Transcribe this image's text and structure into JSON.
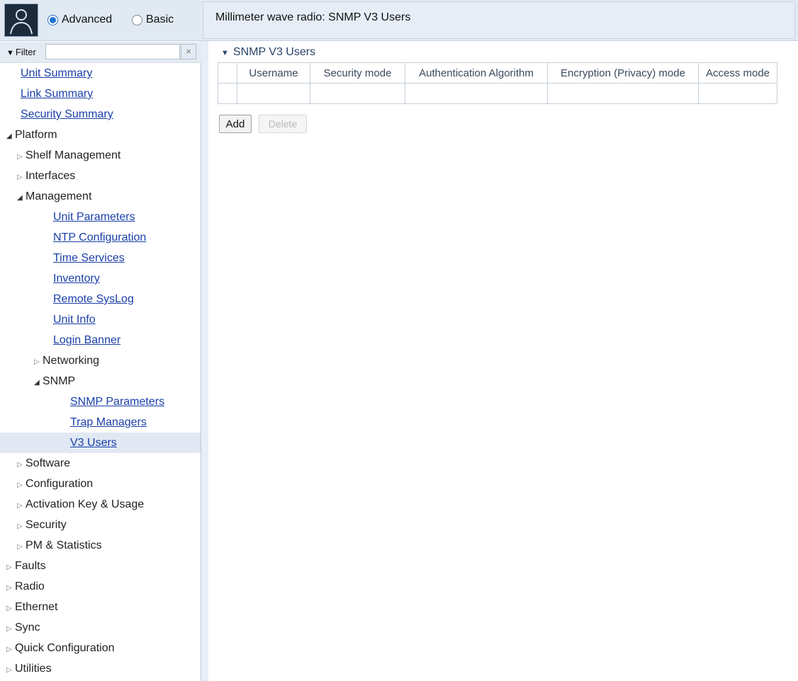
{
  "sidebar": {
    "mode_options": [
      {
        "label": "Advanced",
        "selected": true
      },
      {
        "label": "Basic",
        "selected": false
      }
    ],
    "filter": {
      "label": "Filter",
      "value": "",
      "clear_label": "×"
    },
    "nav": [
      {
        "label": "Unit Summary",
        "level": 0,
        "type": "link"
      },
      {
        "label": "Link Summary",
        "level": 0,
        "type": "link"
      },
      {
        "label": "Security Summary",
        "level": 0,
        "type": "link"
      },
      {
        "label": "Platform",
        "level": 0,
        "type": "folder",
        "expanded": true
      },
      {
        "label": "Shelf Management",
        "level": 1,
        "type": "folder",
        "expanded": false
      },
      {
        "label": "Interfaces",
        "level": 1,
        "type": "folder",
        "expanded": false
      },
      {
        "label": "Management",
        "level": 1,
        "type": "folder",
        "expanded": true
      },
      {
        "label": "Unit Parameters",
        "level": 2,
        "type": "link"
      },
      {
        "label": "NTP Configuration",
        "level": 2,
        "type": "link"
      },
      {
        "label": "Time Services",
        "level": 2,
        "type": "link"
      },
      {
        "label": "Inventory",
        "level": 2,
        "type": "link"
      },
      {
        "label": "Remote SysLog",
        "level": 2,
        "type": "link"
      },
      {
        "label": "Unit Info",
        "level": 2,
        "type": "link"
      },
      {
        "label": "Login Banner",
        "level": 2,
        "type": "link"
      },
      {
        "label": "Networking",
        "level": 2,
        "type": "folder",
        "expanded": false
      },
      {
        "label": "SNMP",
        "level": 2,
        "type": "folder",
        "expanded": true
      },
      {
        "label": "SNMP Parameters",
        "level": 3,
        "type": "link"
      },
      {
        "label": "Trap Managers",
        "level": 3,
        "type": "link"
      },
      {
        "label": "V3 Users",
        "level": 3,
        "type": "link",
        "selected": true
      },
      {
        "label": "Software",
        "level": 1,
        "type": "folder",
        "expanded": false
      },
      {
        "label": "Configuration",
        "level": 1,
        "type": "folder",
        "expanded": false
      },
      {
        "label": "Activation Key & Usage",
        "level": 1,
        "type": "folder",
        "expanded": false
      },
      {
        "label": "Security",
        "level": 1,
        "type": "folder",
        "expanded": false
      },
      {
        "label": "PM & Statistics",
        "level": 1,
        "type": "folder",
        "expanded": false
      },
      {
        "label": "Faults",
        "level": 0,
        "type": "folder",
        "expanded": false
      },
      {
        "label": "Radio",
        "level": 0,
        "type": "folder",
        "expanded": false
      },
      {
        "label": "Ethernet",
        "level": 0,
        "type": "folder",
        "expanded": false
      },
      {
        "label": "Sync",
        "level": 0,
        "type": "folder",
        "expanded": false
      },
      {
        "label": "Quick Configuration",
        "level": 0,
        "type": "folder",
        "expanded": false
      },
      {
        "label": "Utilities",
        "level": 0,
        "type": "folder",
        "expanded": false
      }
    ]
  },
  "main": {
    "title": "Millimeter wave radio: SNMP V3 Users",
    "section_title": "SNMP V3 Users",
    "table": {
      "columns": [
        "",
        "Username",
        "Security mode",
        "Authentication Algorithm",
        "Encryption (Privacy) mode",
        "Access mode"
      ],
      "rows": []
    },
    "buttons": {
      "add": "Add",
      "delete": "Delete"
    }
  },
  "colors": {
    "header_bg": "#e1e9f3",
    "link": "#1a3fa8",
    "selected_bg": "#e1e8f3",
    "radio_accent": "#1f73d6"
  }
}
